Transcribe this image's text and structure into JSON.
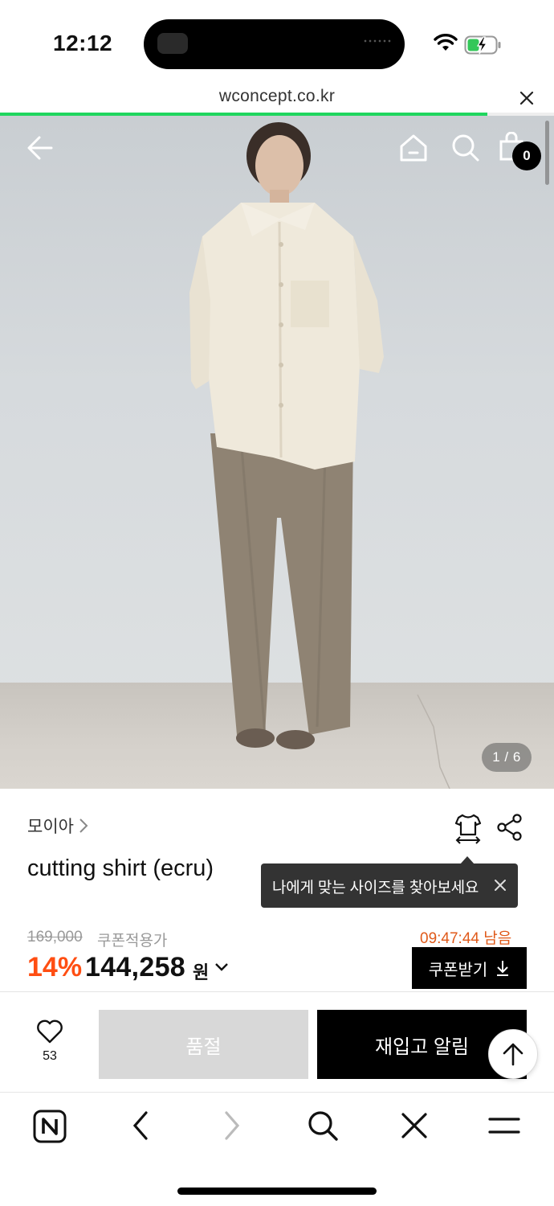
{
  "status_bar": {
    "time": "12:12"
  },
  "browser": {
    "url": "wconcept.co.kr",
    "load_progress": 0.88
  },
  "hero": {
    "cart_count": "0",
    "image_counter": "1 / 6"
  },
  "product": {
    "brand": "모이아",
    "title": "cutting shirt (ecru)",
    "size_tooltip": "나에게 맞는 사이즈를 찾아보세요",
    "original_price": "169,000",
    "coupon_label": "쿠폰적용가",
    "timer": "09:47:44 남음",
    "discount_rate": "14%",
    "sale_price": "144,258",
    "currency": "원",
    "coupon_button": "쿠폰받기"
  },
  "actions": {
    "wish_count": "53",
    "soldout_label": "품절",
    "restock_label": "재입고 알림"
  },
  "colors": {
    "accent_orange": "#ff4e12",
    "timer_orange": "#e05a1a",
    "progress_green": "#1fd65e"
  },
  "icons": [
    "back-arrow-icon",
    "home-icon",
    "search-icon",
    "shopping-bag-icon",
    "size-guide-icon",
    "share-icon",
    "close-icon",
    "heart-icon",
    "arrow-up-icon",
    "naver-icon",
    "chevron-left-icon",
    "chevron-right-icon",
    "menu-icon"
  ]
}
